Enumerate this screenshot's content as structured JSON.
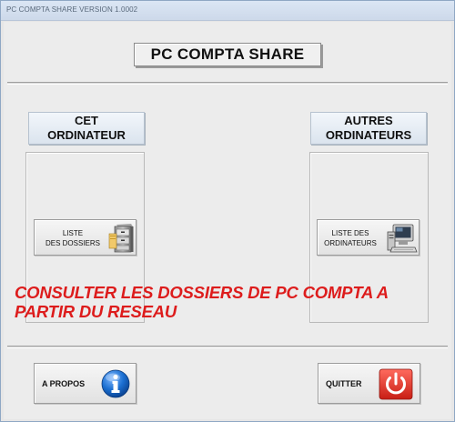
{
  "window": {
    "title": "PC COMPTA SHARE VERSION 1.0002"
  },
  "header": {
    "title": "PC COMPTA SHARE"
  },
  "left_section": {
    "label_line1": "CET",
    "label_line2": "ORDINATEUR",
    "button_line1": "LISTE",
    "button_line2": "DES DOSSIERS",
    "icon": "file-cabinet-icon"
  },
  "right_section": {
    "label_line1": "AUTRES",
    "label_line2": "ORDINATEURS",
    "button_line1": "LISTE DES",
    "button_line2": "ORDINATEURS",
    "icon": "computer-icon"
  },
  "tagline": {
    "line1": "CONSULTER LES DOSSIERS DE PC COMPTA A",
    "line2": "PARTIR DU RESEAU",
    "color": "#dd1c1c"
  },
  "footer": {
    "about_label": "A PROPOS",
    "about_icon": "info-icon",
    "quit_label": "QUITTER",
    "quit_icon": "power-icon"
  },
  "colors": {
    "accent_blue": "#1b6fd1",
    "quit_red": "#e03128"
  }
}
